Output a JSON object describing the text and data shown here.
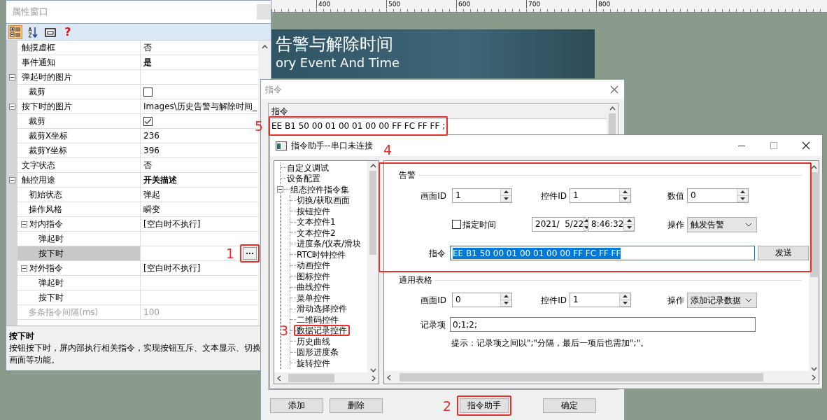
{
  "canvas": {
    "ruler_labels": [
      "400",
      "500",
      "600",
      "700",
      "800"
    ],
    "banner": {
      "title": "告警与解除时间",
      "subtitle": "ory Event And Time"
    }
  },
  "property_window": {
    "title": "属性窗口",
    "toolbar": [
      {
        "kind": "categorized",
        "selected": true
      },
      {
        "kind": "alphabetical",
        "selected": false
      },
      {
        "kind": "pages",
        "selected": false
      },
      {
        "kind": "help",
        "glyph": "?",
        "selected": false
      }
    ],
    "rows": [
      {
        "name": "触摸虚框",
        "value": "否",
        "kind": "text",
        "selected": false
      },
      {
        "name": "事件通知",
        "value": "是",
        "kind": "text",
        "modified": true,
        "selected": false
      },
      {
        "name": "弹起时的图片",
        "kind": "text",
        "expanded": true,
        "selected": false,
        "children": [
          {
            "name": "裁剪",
            "kind": "checkbox",
            "checked": false,
            "selected": false
          }
        ]
      },
      {
        "name": "按下时的图片",
        "value": "Images\\历史告警与解除时间_",
        "kind": "text",
        "expanded": true,
        "selected": false,
        "children": [
          {
            "name": "裁剪",
            "kind": "checkbox",
            "checked": true,
            "selected": false
          },
          {
            "name": "裁剪X坐标",
            "value": "236",
            "kind": "text",
            "selected": false
          },
          {
            "name": "裁剪Y坐标",
            "value": "396",
            "kind": "text",
            "selected": false
          }
        ]
      },
      {
        "name": "文字状态",
        "value": "否",
        "kind": "text",
        "selected": false
      },
      {
        "name": "触控用途",
        "value": "开关描述",
        "kind": "text",
        "modified": true,
        "expanded": true,
        "selected": false,
        "children": [
          {
            "name": "初始状态",
            "value": "弹起",
            "kind": "text",
            "selected": false
          },
          {
            "name": "操作风格",
            "value": "瞬变",
            "kind": "text",
            "selected": false
          },
          {
            "name": "对内指令",
            "value": "[空白时不执行]",
            "kind": "text",
            "expanded": true,
            "selected": false,
            "children": [
              {
                "name": "弹起时",
                "kind": "text",
                "selected": false
              },
              {
                "name": "按下时",
                "kind": "command",
                "button": "...",
                "selected": true
              }
            ]
          },
          {
            "name": "对外指令",
            "value": "[空白时不执行]",
            "kind": "text",
            "expanded": true,
            "selected": false,
            "children": [
              {
                "name": "弹起时",
                "kind": "text",
                "selected": false
              },
              {
                "name": "按下时",
                "kind": "text",
                "selected": false
              }
            ]
          },
          {
            "name": "多条指令间隔(ms)",
            "value": "100",
            "kind": "text",
            "disabled": true,
            "selected": false
          }
        ]
      }
    ],
    "description": {
      "title": "按下时",
      "text": "按钮按下时，屏内部执行相关指令，实现按钮互斥、文本显示、切换画面等功能。"
    }
  },
  "command_dialog": {
    "title": "指令",
    "list_header": "指令",
    "rows": [
      "EE B1 50 00 01 00 01 00 00 FF FC FF FF ;"
    ],
    "buttons": [
      "添加",
      "删除",
      "指令助手",
      "确定"
    ]
  },
  "helper_dialog": {
    "title": "指令助手--串口未连接",
    "tree": [
      {
        "label": "自定义调试"
      },
      {
        "label": "设备配置"
      },
      {
        "label": "组态控件指令集",
        "expanded": true,
        "children": [
          {
            "label": "切换/获取画面"
          },
          {
            "label": "按钮控件"
          },
          {
            "label": "文本控件1"
          },
          {
            "label": "文本控件2"
          },
          {
            "label": "进度条/仪表/滑块"
          },
          {
            "label": "RTC时钟控件"
          },
          {
            "label": "动画控件"
          },
          {
            "label": "图标控件"
          },
          {
            "label": "曲线控件"
          },
          {
            "label": "菜单控件"
          },
          {
            "label": "滑动选择控件"
          },
          {
            "label": "二维码控件"
          },
          {
            "label": "数据记录控件"
          },
          {
            "label": "历史曲线"
          },
          {
            "label": "圆形进度条"
          },
          {
            "label": "旋转控件"
          }
        ]
      }
    ],
    "alarm": {
      "title": "告警",
      "screen_id": {
        "label": "画面ID",
        "value": "1"
      },
      "control_id": {
        "label": "控件ID",
        "value": "1"
      },
      "number": {
        "label": "数值",
        "value": "0"
      },
      "specify_time": {
        "label": "指定时间",
        "checked": false
      },
      "date": "2021/  5/22",
      "time": "8:46:32",
      "operation": {
        "label": "操作",
        "value": "触发告警"
      },
      "command": {
        "label": "指令",
        "value": "EE B1 50 00 01 00 01 00 00 FF FC FF FF",
        "highlighted": true
      },
      "send_button": "发送"
    },
    "table": {
      "title": "通用表格",
      "screen_id": {
        "label": "画面ID",
        "value": "0"
      },
      "control_id": {
        "label": "控件ID",
        "value": "1"
      },
      "operation": {
        "label": "操作",
        "value": "添加记录数据"
      },
      "record": {
        "label": "记录项",
        "value": "0;1;2;"
      },
      "hint": "提示：记录项之间以\";\"分隔，最后一项后也需加\";\"。"
    }
  },
  "annotations": [
    {
      "number": "1"
    },
    {
      "number": "2"
    },
    {
      "number": "3"
    },
    {
      "number": "4"
    },
    {
      "number": "5"
    }
  ]
}
